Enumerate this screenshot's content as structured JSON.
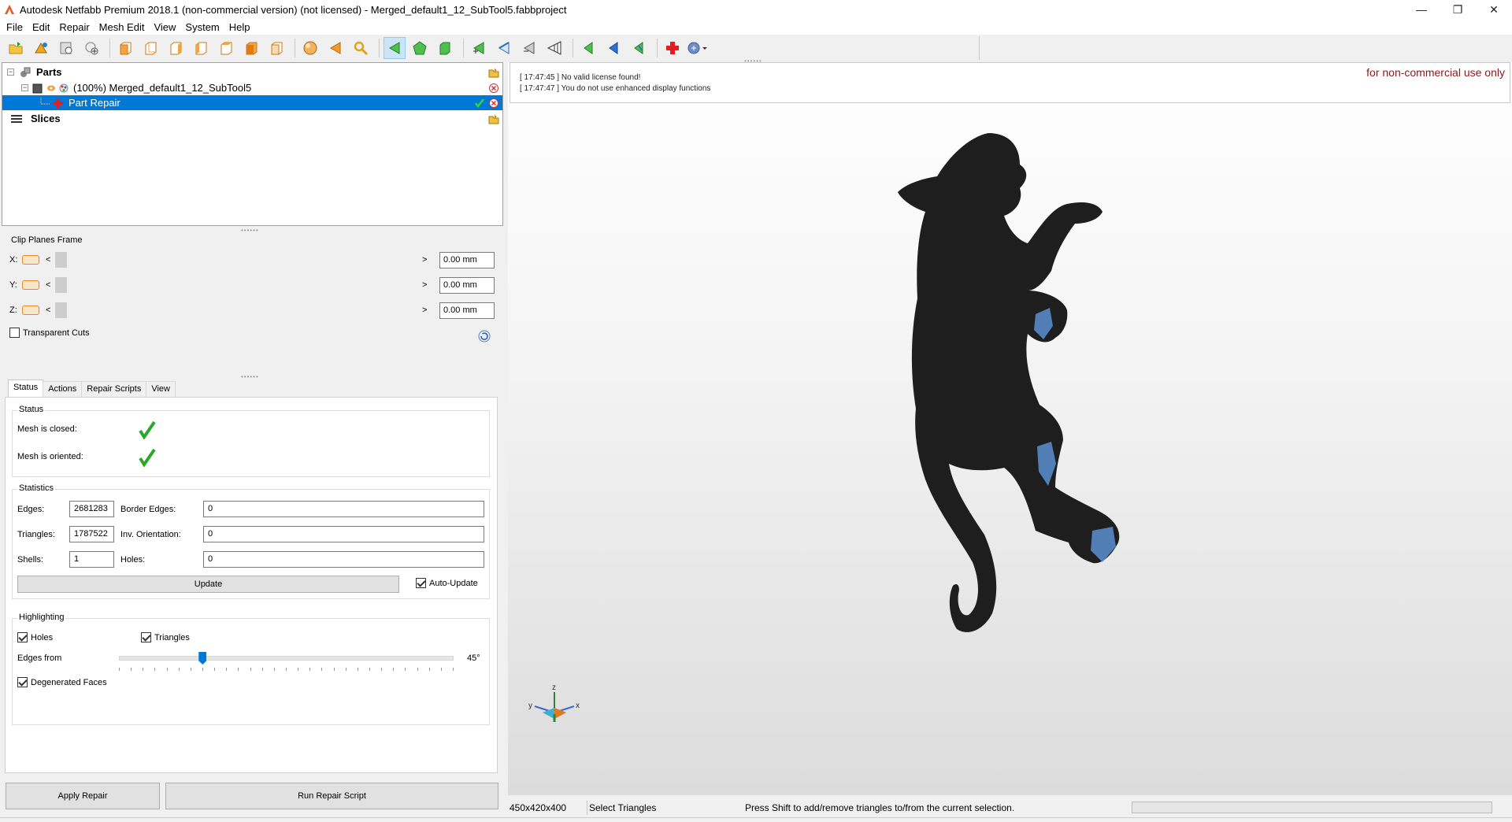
{
  "window": {
    "title": "Autodesk Netfabb Premium 2018.1 (non-commercial version) (not licensed) - Merged_default1_12_SubTool5.fabbproject",
    "minimize": "—",
    "restore": "❐",
    "close": "✕"
  },
  "menu": [
    "File",
    "Edit",
    "Repair",
    "Mesh Edit",
    "View",
    "System",
    "Help"
  ],
  "tree": {
    "parts_label": "Parts",
    "part_label": "(100%) Merged_default1_12_SubTool5",
    "repair_label": "Part Repair",
    "slices_label": "Slices"
  },
  "clip": {
    "title": "Clip Planes Frame",
    "x_label": "X:",
    "y_label": "Y:",
    "z_label": "Z:",
    "left_arrow": "<",
    "right_arrow": ">",
    "x_value": "0.00 mm",
    "y_value": "0.00 mm",
    "z_value": "0.00 mm",
    "transparent_label": "Transparent Cuts"
  },
  "tabs": [
    "Status",
    "Actions",
    "Repair Scripts",
    "View"
  ],
  "status": {
    "group_title": "Status",
    "closed_label": "Mesh is closed:",
    "oriented_label": "Mesh is oriented:"
  },
  "statistics": {
    "group_title": "Statistics",
    "edges_label": "Edges:",
    "edges_value": "2681283",
    "border_label": "Border Edges:",
    "border_value": "0",
    "triangles_label": "Triangles:",
    "triangles_value": "1787522",
    "inv_label": "Inv. Orientation:",
    "inv_value": "0",
    "shells_label": "Shells:",
    "shells_value": "1",
    "holes_label": "Holes:",
    "holes_value": "0",
    "update_label": "Update",
    "auto_update_label": "Auto-Update"
  },
  "highlighting": {
    "group_title": "Highlighting",
    "holes_label": "Holes",
    "triangles_label": "Triangles",
    "edges_from_label": "Edges from",
    "edges_from_value": "45°",
    "slider_fraction": 0.25,
    "degenerated_label": "Degenerated Faces"
  },
  "buttons": {
    "apply_repair": "Apply Repair",
    "run_script": "Run Repair Script"
  },
  "log": {
    "line1": "[ 17:47:45 ] No valid license found!",
    "line2": "[ 17:47:47 ] You do not use enhanced display functions",
    "watermark": "for non-commercial use only"
  },
  "axes": {
    "z": "z",
    "y": "y",
    "x": "x"
  },
  "statusbar": {
    "dimensions": "450x420x400",
    "mode": "Select Triangles",
    "hint": "Press Shift to add/remove triangles to/from the current selection."
  },
  "colors": {
    "selection": "#0078d7",
    "check_green": "#2aa82a",
    "model": "#1e1e1e",
    "highlight_triangles": "#5b8fd0"
  }
}
